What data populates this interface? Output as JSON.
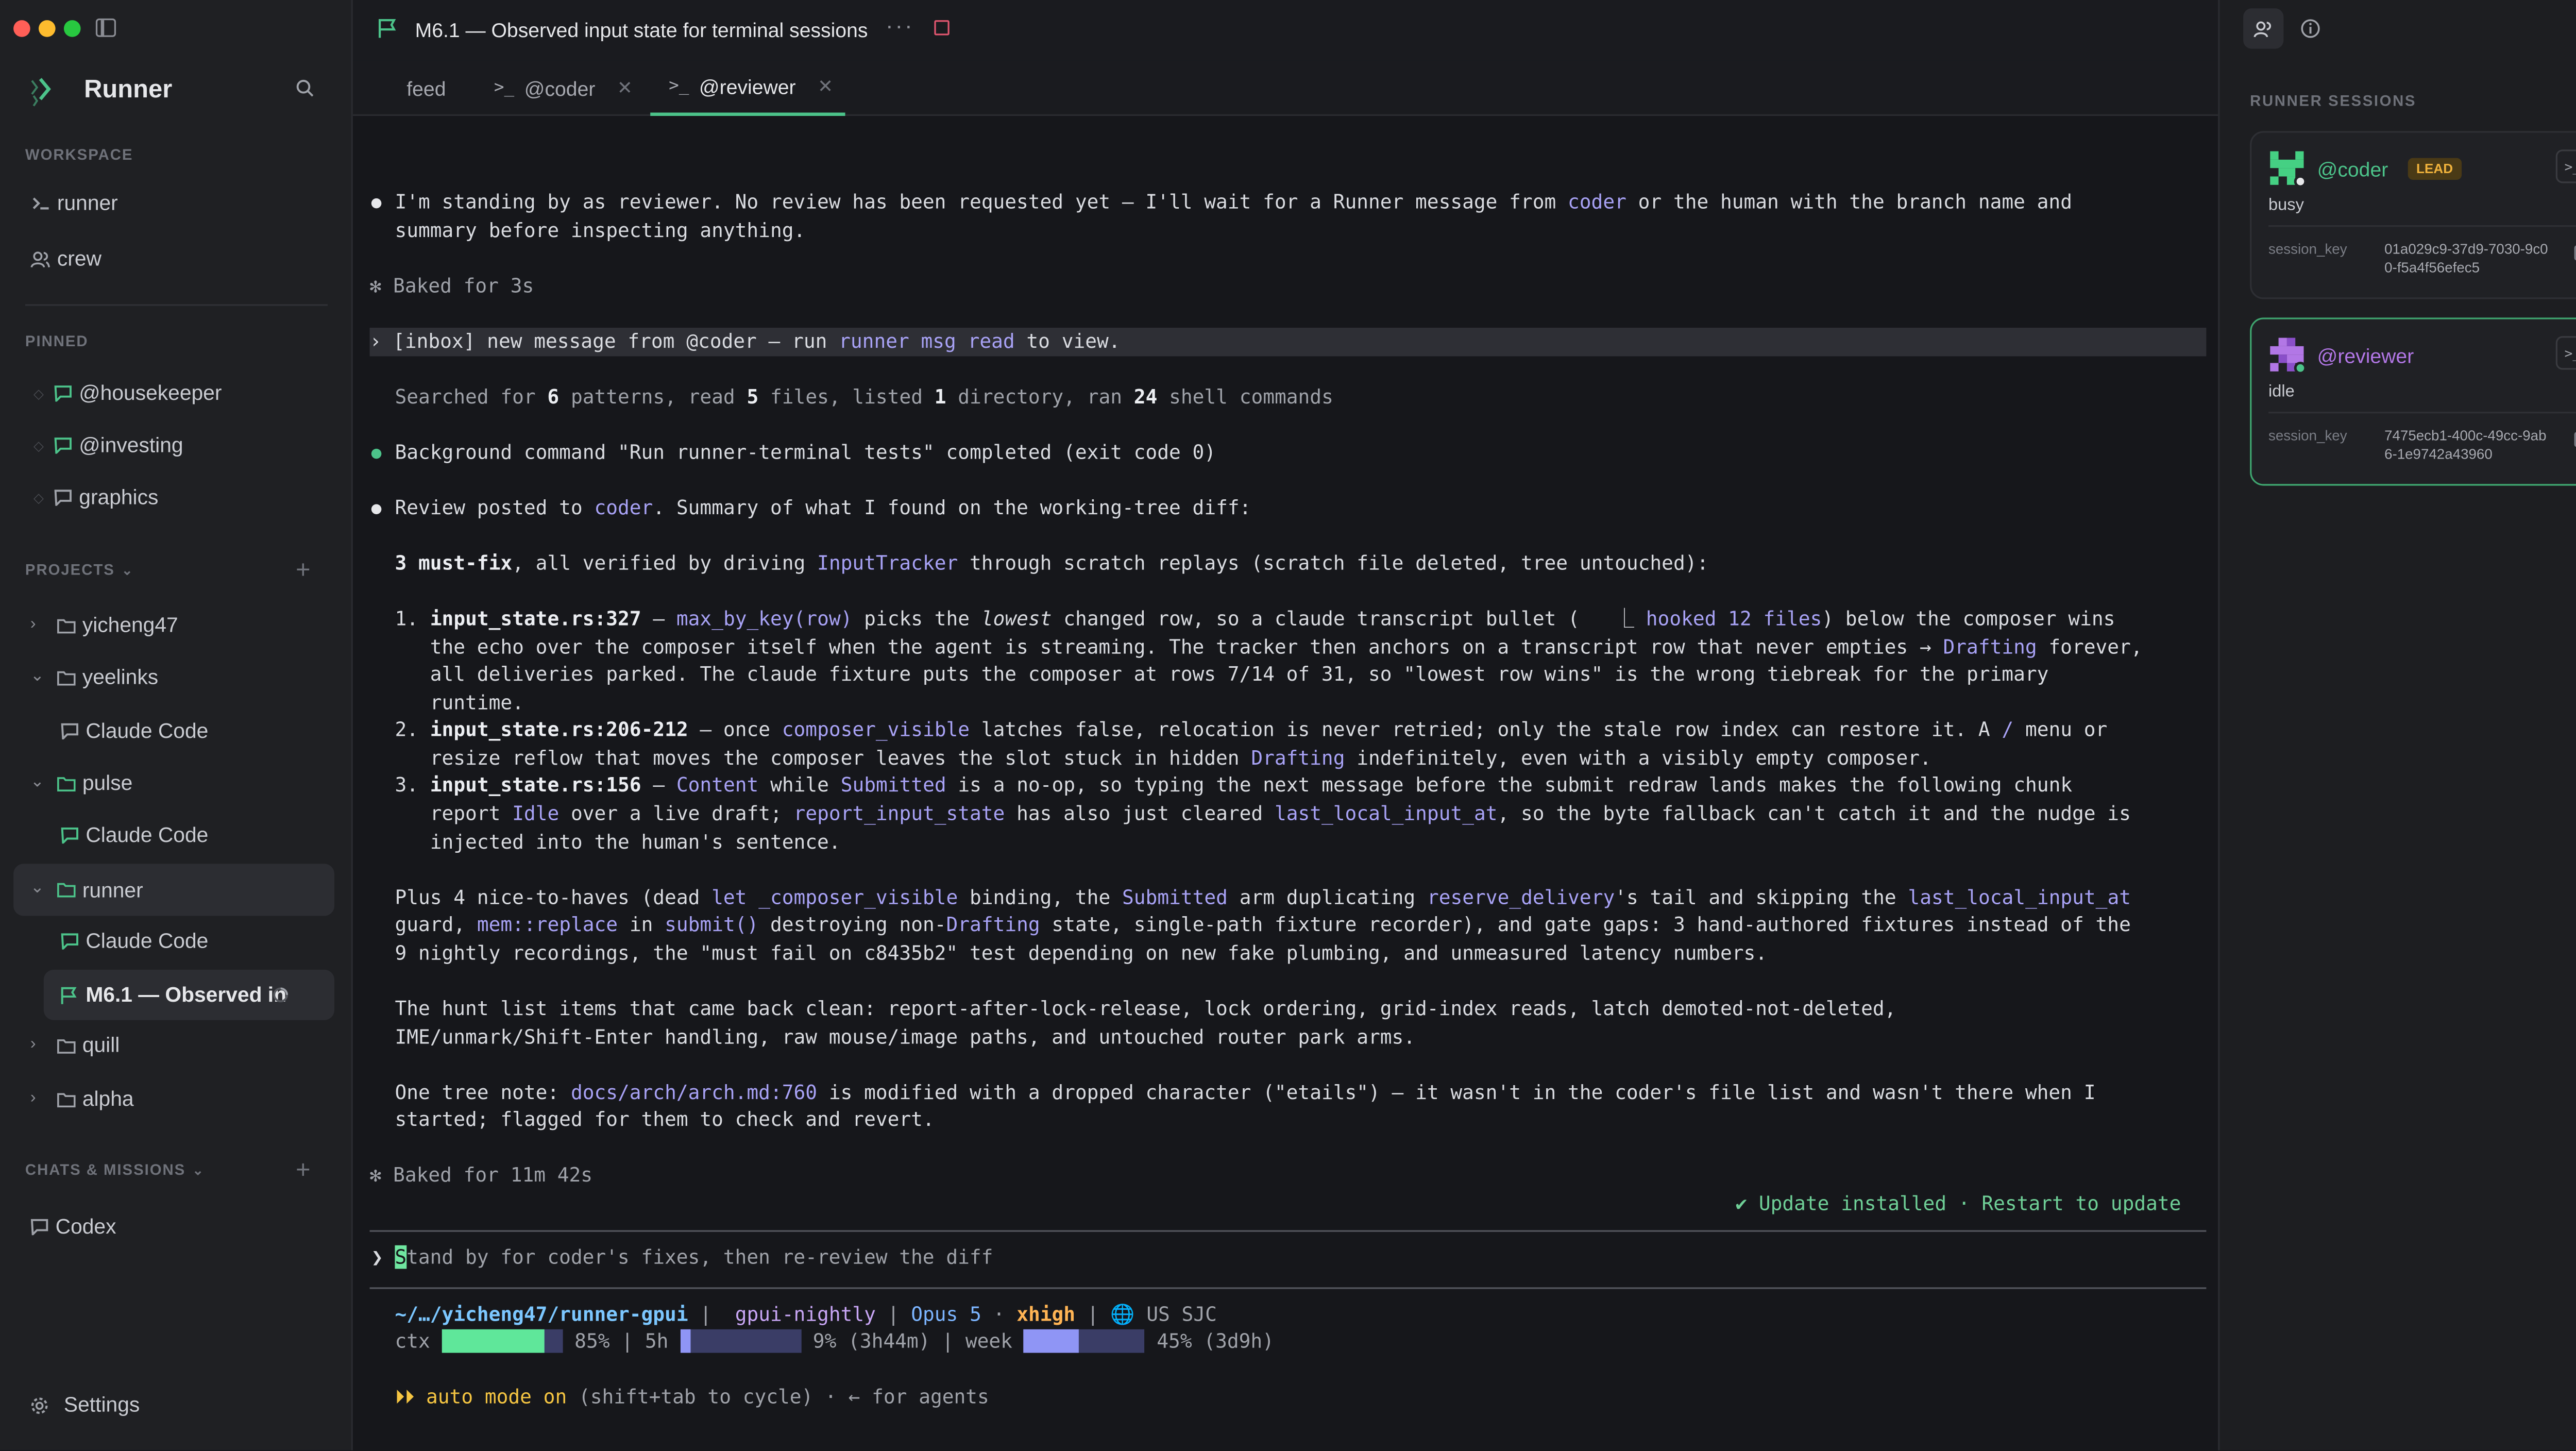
{
  "colors": {
    "accent": "#4cc38a",
    "command": "#a8a2f5",
    "lead_badge": "#f0b23c",
    "update": "#6fcf97",
    "coder_avatar": "#45d083",
    "reviewer_avatar": "#b277e6"
  },
  "app": {
    "name": "Runner"
  },
  "sidebar": {
    "workspace_label": "WORKSPACE",
    "workspace_items": [
      {
        "label": "runner",
        "icon": "terminal-icon"
      },
      {
        "label": "crew",
        "icon": "people-icon"
      }
    ],
    "pinned_label": "PINNED",
    "pinned_items": [
      {
        "label": "@housekeeper"
      },
      {
        "label": "@investing"
      },
      {
        "label": "graphics"
      }
    ],
    "projects_label": "PROJECTS",
    "projects": [
      {
        "label": "yicheng47"
      },
      {
        "label": "yeelinks",
        "children": [
          "Claude Code"
        ]
      },
      {
        "label": "pulse",
        "children": [
          "Claude Code"
        ]
      },
      {
        "label": "runner",
        "children": [
          "Claude Code",
          "M6.1 — Observed in"
        ]
      },
      {
        "label": "quill"
      },
      {
        "label": "alpha"
      }
    ],
    "chats_label": "CHATS & MISSIONS",
    "chats": [
      {
        "label": "Codex"
      }
    ],
    "settings_label": "Settings"
  },
  "header": {
    "mission_title": "M6.1 — Observed input state for terminal sessions"
  },
  "tabs": [
    {
      "label": "feed"
    },
    {
      "label": "@coder"
    },
    {
      "label": "@reviewer"
    }
  ],
  "terminal": {
    "l1a": "I'm standing by as reviewer. No review has been requested yet — I'll wait for a Runner message from ",
    "l1b": "coder",
    "l1c": " or the human with the branch name and",
    "l2": "summary before inspecting anything.",
    "baked1": "✻ Baked for 3s",
    "inbox_a": "› [inbox] new message from @coder — run ",
    "inbox_b": "runner msg read",
    "inbox_c": " to view.",
    "searched": [
      "Searched for ",
      "6",
      " patterns, read ",
      "5",
      " files, listed ",
      "1",
      " directory, ran ",
      "24",
      " shell commands"
    ],
    "bg_cmd": "Background command \"Run runner-terminal tests\" completed (exit code 0)",
    "review_a": "Review posted to ",
    "review_b": "coder",
    "review_c": ". Summary of what I found on the working-tree diff:",
    "mustfix_a": "3 must-fix",
    "mustfix_b": ", all verified by driving ",
    "mustfix_c": "InputTracker",
    "mustfix_d": " through scratch replays (scratch file deleted, tree untouched):",
    "i1": [
      "1. ",
      "input_state.rs:327",
      " — ",
      "max_by_key(row)",
      " picks the ",
      "lowest",
      " changed row, so a claude transcript bullet (   ⎿ ",
      "hooked 12 files",
      ") below the composer wins"
    ],
    "i1_2a": "   the echo over the composer itself when the agent is streaming. The tracker then anchors on a transcript row that never empties → ",
    "i1_2b": "Drafting",
    "i1_2c": " forever,",
    "i1_3": "   all deliveries parked. The claude fixture puts the composer at rows 7/14 of 31, so \"lowest row wins\" is the wrong tiebreak for the primary",
    "i1_4": "   runtime.",
    "i2": [
      "2. ",
      "input_state.rs:206-212",
      " — once ",
      "composer_visible",
      " latches false, relocation is never retried; only the stale row index can restore it. A ",
      "/",
      " menu or"
    ],
    "i2_2a": "   resize reflow that moves the composer leaves the slot stuck in hidden ",
    "i2_2b": "Drafting",
    "i2_2c": " indefinitely, even with a visibly empty composer.",
    "i3": [
      "3. ",
      "input_state.rs:156",
      " — ",
      "Content",
      " while ",
      "Submitted",
      " is a no-op, so typing the next message before the submit redraw lands makes the following chunk"
    ],
    "i3_2": [
      "   report ",
      "Idle",
      " over a live draft; ",
      "report_input_state",
      " has also just cleared ",
      "last_local_input_at",
      ", so the byte fallback can't catch it and the nudge is"
    ],
    "i3_3": "   injected into the human's sentence.",
    "p1": [
      "Plus 4 nice-to-haves (dead ",
      "let _composer_visible",
      " binding, the ",
      "Submitted",
      " arm duplicating ",
      "reserve_delivery",
      "'s tail and skipping the ",
      "last_local_input_at"
    ],
    "p2": [
      "guard, ",
      "mem::replace",
      " in ",
      "submit()",
      " destroying non-",
      "Drafting",
      " state, single-path fixture recorder), and gate gaps: 3 hand-authored fixtures instead of the"
    ],
    "p3": "9 nightly recordings, the \"must fail on c8435b2\" test depending on new fake plumbing, and unmeasured latency numbers.",
    "h1": "The hunt list items that came back clean: report-after-lock-release, lock ordering, grid-index reads, latch demoted-not-deleted,",
    "h2": "IME/unmark/Shift-Enter handling, raw mouse/image paths, and untouched router park arms.",
    "t1a": "One tree note: ",
    "t1b": "docs/arch/arch.md:760",
    "t1c": " is modified with a dropped character (\"etails\") — it wasn't in the coder's file list and wasn't there when I",
    "t2": "started; flagged for them to check and revert.",
    "baked2": "✻ Baked for 11m 42s",
    "update": "✔ Update installed · Restart to update",
    "prompt_symbol": "❯ ",
    "input_first": "S",
    "input_rest": "tand by for coder's fixes, then re-review the diff",
    "status": {
      "path": "~/…/yicheng47/runner-gpui",
      "branch": "gpui-nightly",
      "model": "Opus 5",
      "effort": "xhigh",
      "region": "US SJC",
      "ctx_label": "ctx",
      "ctx_pct": 0.85,
      "ctx_text": "85%",
      "h5_label": "5h",
      "h5_pct": 0.09,
      "h5_text": "9% (3h44m)",
      "week_label": "week",
      "week_pct": 0.45,
      "week_text": "45% (3d9h)"
    },
    "auto_a": "⏵⏵ auto mode on",
    "auto_b": " (shift+tab to cycle) · ← for agents"
  },
  "right_panel": {
    "label": "RUNNER SESSIONS",
    "sessions": [
      {
        "name": "@coder",
        "badge": "LEAD",
        "state": "busy",
        "key_label": "session_key",
        "key": "01a029c9-37d9-7030-9c00-f5a4f56efec5",
        "color": "#45d083"
      },
      {
        "name": "@reviewer",
        "state": "idle",
        "key_label": "session_key",
        "key": "7475ecb1-400c-49cc-9ab6-1e9742a43960",
        "color": "#b277e6"
      }
    ]
  }
}
